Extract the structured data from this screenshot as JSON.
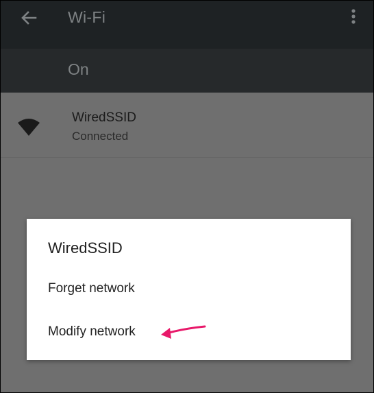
{
  "appbar": {
    "title": "Wi-Fi",
    "back_icon": "arrow-back-icon",
    "more_icon": "more-vert-icon"
  },
  "wifi_switch": {
    "label": "On",
    "enabled": true
  },
  "network": {
    "icon": "wifi-signal-icon",
    "name": "WiredSSID",
    "status": "Connected"
  },
  "dialog": {
    "title": "WiredSSID",
    "options": [
      {
        "label": "Forget network"
      },
      {
        "label": "Modify network"
      }
    ]
  },
  "annotation": {
    "icon": "pointer-arrow-icon",
    "color": "#e8196a"
  },
  "colors": {
    "appbar_bg": "#1e2224",
    "switchbar_bg": "#26292b",
    "scrim_bg": "#6f6f6f",
    "dialog_bg": "#ffffff"
  }
}
